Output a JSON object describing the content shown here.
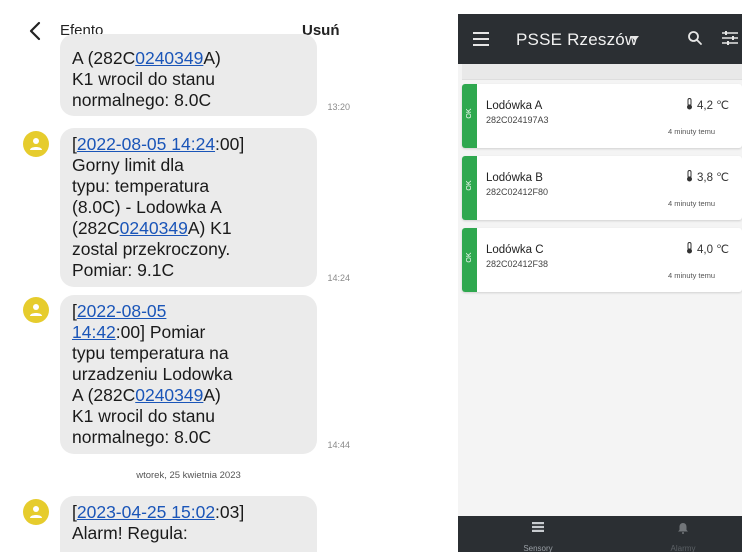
{
  "sms": {
    "contact": "Efento",
    "delete_label": "Usuń",
    "messages": [
      {
        "parts": [
          {
            "text": "A (282C",
            "link": false
          },
          {
            "text": "0240349",
            "link": true
          },
          {
            "text": "A)\nK1 wrocil do stanu\nnormalnego: 8.0C",
            "link": false
          }
        ],
        "time": "13:20"
      },
      {
        "parts": [
          {
            "text": "[",
            "link": false
          },
          {
            "text": "2022-08-05 14:24",
            "link": true
          },
          {
            "text": ":00]\nGorny limit dla\ntypu: temperatura\n(8.0C) - Lodowka A\n(282C",
            "link": false
          },
          {
            "text": "0240349",
            "link": true
          },
          {
            "text": "A) K1\nzostal przekroczony.\nPomiar: 9.1C",
            "link": false
          }
        ],
        "time": "14:24"
      },
      {
        "parts": [
          {
            "text": "[",
            "link": false
          },
          {
            "text": "2022-08-05\n14:42",
            "link": true
          },
          {
            "text": ":00] Pomiar\ntypu temperatura na\nurzadzeniu Lodowka\nA (282C",
            "link": false
          },
          {
            "text": "0240349",
            "link": true
          },
          {
            "text": "A)\nK1 wrocil do stanu\nnormalnego: 8.0C",
            "link": false
          }
        ],
        "time": "14:44"
      },
      {
        "parts": [
          {
            "text": "[",
            "link": false
          },
          {
            "text": "2023-04-25 15:02",
            "link": true
          },
          {
            "text": ":03]\nAlarm! Regula:",
            "link": false
          }
        ],
        "time": ""
      }
    ],
    "date_separator": "wtorek, 25 kwietnia 2023",
    "avatar_color": "#e6cc2d",
    "link_color": "#1a55b8"
  },
  "app": {
    "title": "PSSE Rzeszów",
    "bar_color": "#2b2f33",
    "status_color": "#2fa84f",
    "sensors": [
      {
        "status": "OK",
        "name": "Lodówka A",
        "serial": "282C024197A3",
        "temperature": "4,2 ℃",
        "updated": "4 minuty temu"
      },
      {
        "status": "OK",
        "name": "Lodówka B",
        "serial": "282C02412F80",
        "temperature": "3,8 ℃",
        "updated": "4 minuty temu"
      },
      {
        "status": "OK",
        "name": "Lodówka C",
        "serial": "282C02412F38",
        "temperature": "4,0 ℃",
        "updated": "4 minuty temu"
      }
    ],
    "nav": [
      {
        "label": "Sensory",
        "icon": "list-icon",
        "active": true
      },
      {
        "label": "Alarmy",
        "icon": "bell-icon",
        "active": false
      }
    ]
  }
}
